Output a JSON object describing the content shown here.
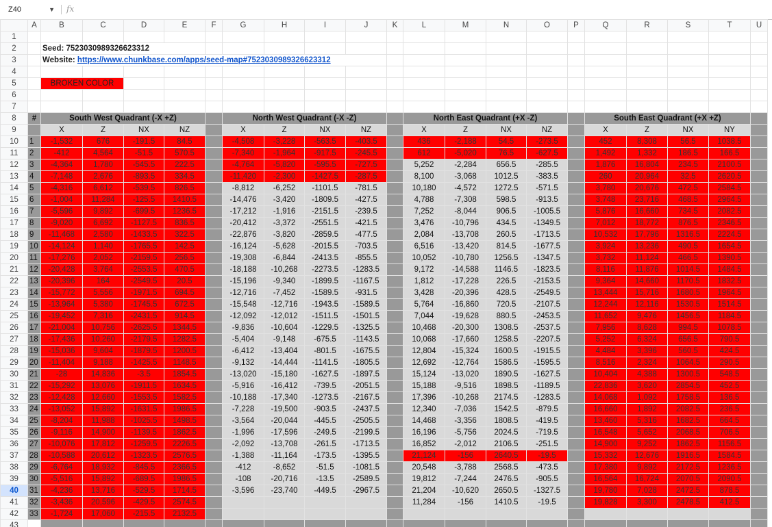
{
  "formula_bar": {
    "name_box": "Z40",
    "fx": "fx"
  },
  "selected_row": 40,
  "columns": [
    "",
    "A",
    "B",
    "C",
    "D",
    "E",
    "F",
    "G",
    "H",
    "I",
    "J",
    "K",
    "L",
    "M",
    "N",
    "O",
    "P",
    "Q",
    "R",
    "S",
    "T",
    "U"
  ],
  "seed_label": "Seed: 7523030989326623312",
  "website_label": "Website:",
  "website_url": "https://www.chunkbase.com/apps/seed-map#7523030989326623312",
  "broken_label": "BROKEN COLOR",
  "hash_label": "#",
  "colors": {
    "broken": "#ff0000",
    "gray": "#999999",
    "light_gray": "#d9d9d9",
    "link": "#1155cc"
  },
  "quadrants": [
    {
      "title": "South West Quadrant (-X +Z)",
      "headers": [
        "X",
        "Z",
        "NX",
        "NZ"
      ],
      "broken_rows": 33,
      "rows": [
        [
          "-1,532",
          "676",
          "-191.5",
          "84.5"
        ],
        [
          "-412",
          "4,564",
          "-51.5",
          "570.5"
        ],
        [
          "-4,364",
          "1,780",
          "-545.5",
          "222.5"
        ],
        [
          "-7,148",
          "2,676",
          "-893.5",
          "334.5"
        ],
        [
          "-4,316",
          "6,612",
          "-539.5",
          "826.5"
        ],
        [
          "-1,004",
          "11,284",
          "-125.5",
          "1410.5"
        ],
        [
          "-5,596",
          "9,892",
          "-699.5",
          "1236.5"
        ],
        [
          "-9,020",
          "6,692",
          "-1127.5",
          "836.5"
        ],
        [
          "-11,468",
          "2,580",
          "-1433.5",
          "322.5"
        ],
        [
          "-14,124",
          "1,140",
          "-1765.5",
          "142.5"
        ],
        [
          "-17,276",
          "2,052",
          "-2159.5",
          "256.5"
        ],
        [
          "-20,428",
          "3,764",
          "-2553.5",
          "470.5"
        ],
        [
          "-20,396",
          "164",
          "-2549.5",
          "20.5"
        ],
        [
          "-15,772",
          "5,556",
          "-1971.5",
          "694.5"
        ],
        [
          "-13,964",
          "5,380",
          "-1745.5",
          "672.5"
        ],
        [
          "-19,452",
          "7,316",
          "-2431.5",
          "914.5"
        ],
        [
          "-21,004",
          "10,756",
          "-2625.5",
          "1344.5"
        ],
        [
          "-17,436",
          "10,260",
          "-2179.5",
          "1282.5"
        ],
        [
          "-15,036",
          "9,604",
          "-1879.5",
          "1200.5"
        ],
        [
          "-11,404",
          "9,188",
          "-1425.5",
          "1148.5"
        ],
        [
          "-28",
          "14,836",
          "-3.5",
          "1854.5"
        ],
        [
          "-15,292",
          "13,076",
          "-1911.5",
          "1634.5"
        ],
        [
          "-12,428",
          "12,660",
          "-1553.5",
          "1582.5"
        ],
        [
          "-13,052",
          "15,892",
          "-1631.5",
          "1986.5"
        ],
        [
          "-8,204",
          "11,988",
          "-1025.5",
          "1498.5"
        ],
        [
          "-9,116",
          "14,900",
          "-1139.5",
          "1862.5"
        ],
        [
          "-10,076",
          "17,812",
          "-1259.5",
          "2226.5"
        ],
        [
          "-10,588",
          "20,612",
          "-1323.5",
          "2576.5"
        ],
        [
          "-6,764",
          "18,932",
          "-845.5",
          "2366.5"
        ],
        [
          "-5,516",
          "15,892",
          "-689.5",
          "1986.5"
        ],
        [
          "-4,236",
          "13,716",
          "-529.5",
          "1714.5"
        ],
        [
          "-3,436",
          "20,596",
          "-429.5",
          "2574.5"
        ],
        [
          "-1,724",
          "17,060",
          "-215.5",
          "2132.5"
        ]
      ]
    },
    {
      "title": "North West Quadrant (-X -Z)",
      "headers": [
        "X",
        "Z",
        "NX",
        "NZ"
      ],
      "broken_rows": 4,
      "rows": [
        [
          "-4,508",
          "-3,228",
          "-563.5",
          "-403.5"
        ],
        [
          "-7,340",
          "-1,964",
          "-917.5",
          "-245.5"
        ],
        [
          "-4,764",
          "-5,820",
          "-595.5",
          "-727.5"
        ],
        [
          "-11,420",
          "-2,300",
          "-1427.5",
          "-287.5"
        ],
        [
          "-8,812",
          "-6,252",
          "-1101.5",
          "-781.5"
        ],
        [
          "-14,476",
          "-3,420",
          "-1809.5",
          "-427.5"
        ],
        [
          "-17,212",
          "-1,916",
          "-2151.5",
          "-239.5"
        ],
        [
          "-20,412",
          "-3,372",
          "-2551.5",
          "-421.5"
        ],
        [
          "-22,876",
          "-3,820",
          "-2859.5",
          "-477.5"
        ],
        [
          "-16,124",
          "-5,628",
          "-2015.5",
          "-703.5"
        ],
        [
          "-19,308",
          "-6,844",
          "-2413.5",
          "-855.5"
        ],
        [
          "-18,188",
          "-10,268",
          "-2273.5",
          "-1283.5"
        ],
        [
          "-15,196",
          "-9,340",
          "-1899.5",
          "-1167.5"
        ],
        [
          "-12,716",
          "-7,452",
          "-1589.5",
          "-931.5"
        ],
        [
          "-15,548",
          "-12,716",
          "-1943.5",
          "-1589.5"
        ],
        [
          "-12,092",
          "-12,012",
          "-1511.5",
          "-1501.5"
        ],
        [
          "-9,836",
          "-10,604",
          "-1229.5",
          "-1325.5"
        ],
        [
          "-5,404",
          "-9,148",
          "-675.5",
          "-1143.5"
        ],
        [
          "-6,412",
          "-13,404",
          "-801.5",
          "-1675.5"
        ],
        [
          "-9,132",
          "-14,444",
          "-1141.5",
          "-1805.5"
        ],
        [
          "-13,020",
          "-15,180",
          "-1627.5",
          "-1897.5"
        ],
        [
          "-5,916",
          "-16,412",
          "-739.5",
          "-2051.5"
        ],
        [
          "-10,188",
          "-17,340",
          "-1273.5",
          "-2167.5"
        ],
        [
          "-7,228",
          "-19,500",
          "-903.5",
          "-2437.5"
        ],
        [
          "-3,564",
          "-20,044",
          "-445.5",
          "-2505.5"
        ],
        [
          "-1,996",
          "-17,596",
          "-249.5",
          "-2199.5"
        ],
        [
          "-2,092",
          "-13,708",
          "-261.5",
          "-1713.5"
        ],
        [
          "-1,388",
          "-11,164",
          "-173.5",
          "-1395.5"
        ],
        [
          "-412",
          "-8,652",
          "-51.5",
          "-1081.5"
        ],
        [
          "-108",
          "-20,716",
          "-13.5",
          "-2589.5"
        ],
        [
          "-3,596",
          "-23,740",
          "-449.5",
          "-2967.5"
        ],
        [
          "",
          "",
          "",
          ""
        ],
        [
          "",
          "",
          "",
          ""
        ]
      ]
    },
    {
      "title": "North East Quadrant (+X -Z)",
      "headers": [
        "X",
        "Z",
        "NX",
        "NZ"
      ],
      "broken_rows": 2,
      "broken_extra": [
        28
      ],
      "rows": [
        [
          "436",
          "-2,188",
          "54.5",
          "-273.5"
        ],
        [
          "612",
          "-5,020",
          "76.5",
          "-627.5"
        ],
        [
          "5,252",
          "-2,284",
          "656.5",
          "-285.5"
        ],
        [
          "8,100",
          "-3,068",
          "1012.5",
          "-383.5"
        ],
        [
          "10,180",
          "-4,572",
          "1272.5",
          "-571.5"
        ],
        [
          "4,788",
          "-7,308",
          "598.5",
          "-913.5"
        ],
        [
          "7,252",
          "-8,044",
          "906.5",
          "-1005.5"
        ],
        [
          "3,476",
          "-10,796",
          "434.5",
          "-1349.5"
        ],
        [
          "2,084",
          "-13,708",
          "260.5",
          "-1713.5"
        ],
        [
          "6,516",
          "-13,420",
          "814.5",
          "-1677.5"
        ],
        [
          "10,052",
          "-10,780",
          "1256.5",
          "-1347.5"
        ],
        [
          "9,172",
          "-14,588",
          "1146.5",
          "-1823.5"
        ],
        [
          "1,812",
          "-17,228",
          "226.5",
          "-2153.5"
        ],
        [
          "3,428",
          "-20,396",
          "428.5",
          "-2549.5"
        ],
        [
          "5,764",
          "-16,860",
          "720.5",
          "-2107.5"
        ],
        [
          "7,044",
          "-19,628",
          "880.5",
          "-2453.5"
        ],
        [
          "10,468",
          "-20,300",
          "1308.5",
          "-2537.5"
        ],
        [
          "10,068",
          "-17,660",
          "1258.5",
          "-2207.5"
        ],
        [
          "12,804",
          "-15,324",
          "1600.5",
          "-1915.5"
        ],
        [
          "12,692",
          "-12,764",
          "1586.5",
          "-1595.5"
        ],
        [
          "15,124",
          "-13,020",
          "1890.5",
          "-1627.5"
        ],
        [
          "15,188",
          "-9,516",
          "1898.5",
          "-1189.5"
        ],
        [
          "17,396",
          "-10,268",
          "2174.5",
          "-1283.5"
        ],
        [
          "12,340",
          "-7,036",
          "1542.5",
          "-879.5"
        ],
        [
          "14,468",
          "-3,356",
          "1808.5",
          "-419.5"
        ],
        [
          "16,196",
          "-5,756",
          "2024.5",
          "-719.5"
        ],
        [
          "16,852",
          "-2,012",
          "2106.5",
          "-251.5"
        ],
        [
          "21,124",
          "-156",
          "2640.5",
          "-19.5"
        ],
        [
          "20,548",
          "-3,788",
          "2568.5",
          "-473.5"
        ],
        [
          "19,812",
          "-7,244",
          "2476.5",
          "-905.5"
        ],
        [
          "21,204",
          "-10,620",
          "2650.5",
          "-1327.5"
        ],
        [
          "11,284",
          "-156",
          "1410.5",
          "-19.5"
        ],
        [
          "",
          "",
          "",
          ""
        ]
      ]
    },
    {
      "title": "South East Quadrant (+X +Z)",
      "headers": [
        "X",
        "Z",
        "NX",
        "NY"
      ],
      "broken_rows": 32,
      "rows": [
        [
          "452",
          "8,308",
          "56.5",
          "1038.5"
        ],
        [
          "1,492",
          "1,332",
          "186.5",
          "166.5"
        ],
        [
          "1,876",
          "16,804",
          "234.5",
          "2100.5"
        ],
        [
          "260",
          "20,964",
          "32.5",
          "2620.5"
        ],
        [
          "3,780",
          "20,676",
          "472.5",
          "2584.5"
        ],
        [
          "3,748",
          "23,716",
          "468.5",
          "2964.5"
        ],
        [
          "5,876",
          "16,660",
          "734.5",
          "2082.5"
        ],
        [
          "7,012",
          "18,772",
          "876.5",
          "2346.5"
        ],
        [
          "10,532",
          "17,796",
          "1316.5",
          "2224.5"
        ],
        [
          "3,924",
          "13,236",
          "490.5",
          "1654.5"
        ],
        [
          "3,732",
          "11,124",
          "466.5",
          "1390.5"
        ],
        [
          "8,116",
          "11,876",
          "1014.5",
          "1484.5"
        ],
        [
          "9,364",
          "14,660",
          "1170.5",
          "1832.5"
        ],
        [
          "13,444",
          "15,716",
          "1680.5",
          "1964.5"
        ],
        [
          "12,244",
          "12,116",
          "1530.5",
          "1514.5"
        ],
        [
          "11,652",
          "9,476",
          "1456.5",
          "1184.5"
        ],
        [
          "7,956",
          "8,628",
          "994.5",
          "1078.5"
        ],
        [
          "5,252",
          "6,324",
          "656.5",
          "790.5"
        ],
        [
          "4,484",
          "3,396",
          "560.5",
          "424.5"
        ],
        [
          "8,516",
          "2,324",
          "1064.5",
          "290.5"
        ],
        [
          "10,404",
          "4,388",
          "1300.5",
          "548.5"
        ],
        [
          "22,836",
          "3,620",
          "2854.5",
          "452.5"
        ],
        [
          "14,068",
          "1,092",
          "1758.5",
          "136.5"
        ],
        [
          "16,660",
          "1,892",
          "2082.5",
          "236.5"
        ],
        [
          "13,460",
          "5,316",
          "1682.5",
          "664.5"
        ],
        [
          "16,548",
          "5,652",
          "2068.5",
          "706.5"
        ],
        [
          "14,900",
          "9,252",
          "1862.5",
          "1156.5"
        ],
        [
          "15,332",
          "12,676",
          "1916.5",
          "1584.5"
        ],
        [
          "17,380",
          "9,892",
          "2172.5",
          "1236.5"
        ],
        [
          "16,564",
          "16,724",
          "2070.5",
          "2090.5"
        ],
        [
          "19,780",
          "7,028",
          "2472.5",
          "878.5"
        ],
        [
          "19,828",
          "3,300",
          "2478.5",
          "412.5"
        ],
        [
          "",
          "",
          "",
          ""
        ]
      ]
    }
  ]
}
